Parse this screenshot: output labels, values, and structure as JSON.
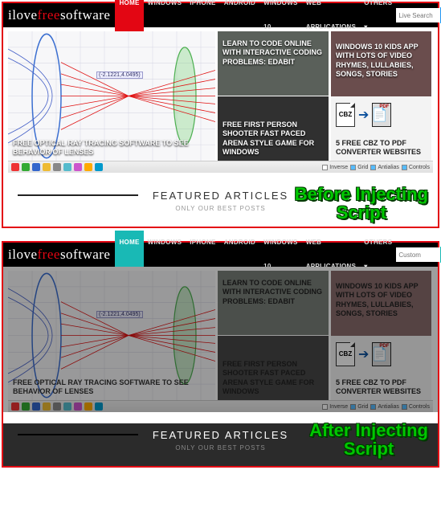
{
  "logo": {
    "part1": "i",
    "part2": "love",
    "part3": "free",
    "part4": "software"
  },
  "nav": {
    "items": [
      "HOME",
      "WINDOWS",
      "IPHONE",
      "ANDROID",
      "WINDOWS 10",
      "WEB APPLICATIONS",
      "OTHERS ▾"
    ]
  },
  "search": {
    "placeholder_before": "Live Search",
    "placeholder_after": "Custom"
  },
  "tiles": {
    "big": "FREE OPTICAL RAY TRACING SOFTWARE TO SEE BEHAVIOR OF LENSES",
    "coordlabel": "(-2.1221,4.0495)",
    "toolbar": {
      "inverse": "Inverse",
      "grid": "Grid",
      "antialias": "Antialias",
      "controls": "Controls"
    },
    "mid1": "LEARN TO CODE ONLINE WITH INTERACTIVE CODING PROBLEMS: EDABIT",
    "mid2": "FREE FIRST PERSON SHOOTER FAST PACED ARENA STYLE GAME FOR WINDOWS",
    "right1": "WINDOWS 10 KIDS APP WITH LOTS OF VIDEO RHYMES, LULLABIES, SONGS, STORIES",
    "right2": "5 FREE CBZ TO PDF CONVERTER WEBSITES",
    "cbz": "CBZ",
    "pdf": "PDF"
  },
  "featured": {
    "title": "FEATURED ARTICLES",
    "sub": "ONLY OUR BEST POSTS"
  },
  "annotation": {
    "before_l1": "Before Injecting",
    "before_l2": "Script",
    "after_l1": "After Injecting",
    "after_l2": "Script"
  }
}
